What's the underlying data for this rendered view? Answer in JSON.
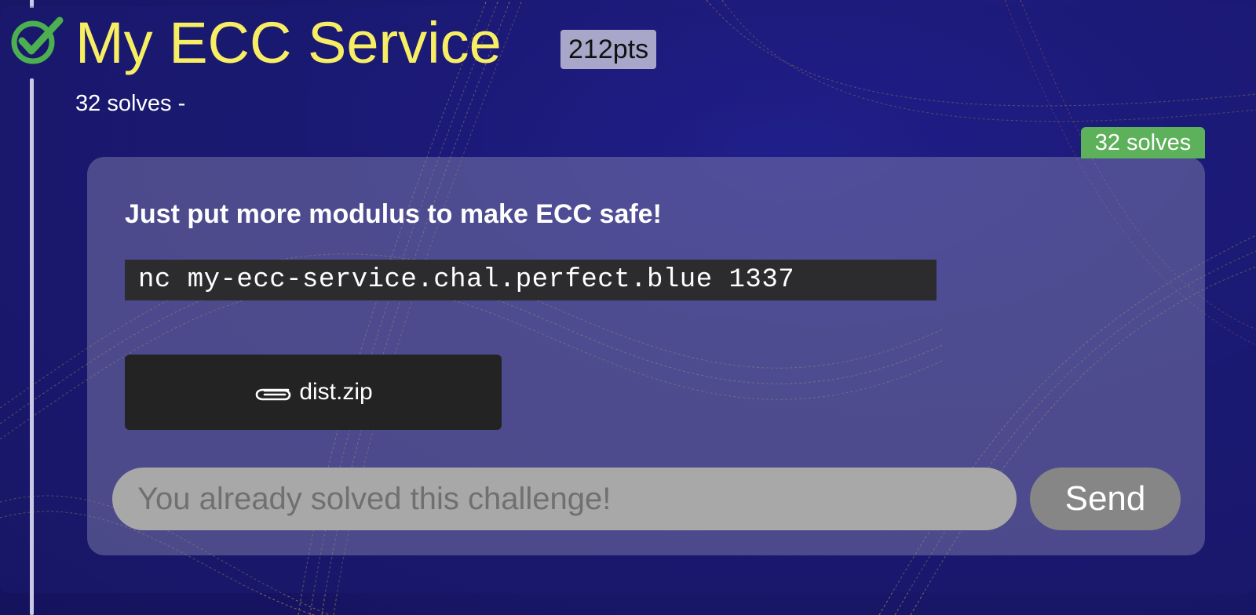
{
  "challenge": {
    "title": "My ECC Service",
    "points": "212pts",
    "solves_subtitle": "32 solves -",
    "solves_badge": "32 solves",
    "description": "Just put more modulus to make ECC safe!",
    "connection": "nc my-ecc-service.chal.perfect.blue 1337",
    "solved": true
  },
  "attachment": {
    "icon": "paperclip-icon",
    "label": "dist.zip"
  },
  "flag_form": {
    "placeholder": "You already solved this challenge!",
    "submit_label": "Send"
  },
  "colors": {
    "title": "#f7ee63",
    "check": "#4caf50",
    "solves_badge": "#5cb15a",
    "background": "#1c1a6e"
  }
}
